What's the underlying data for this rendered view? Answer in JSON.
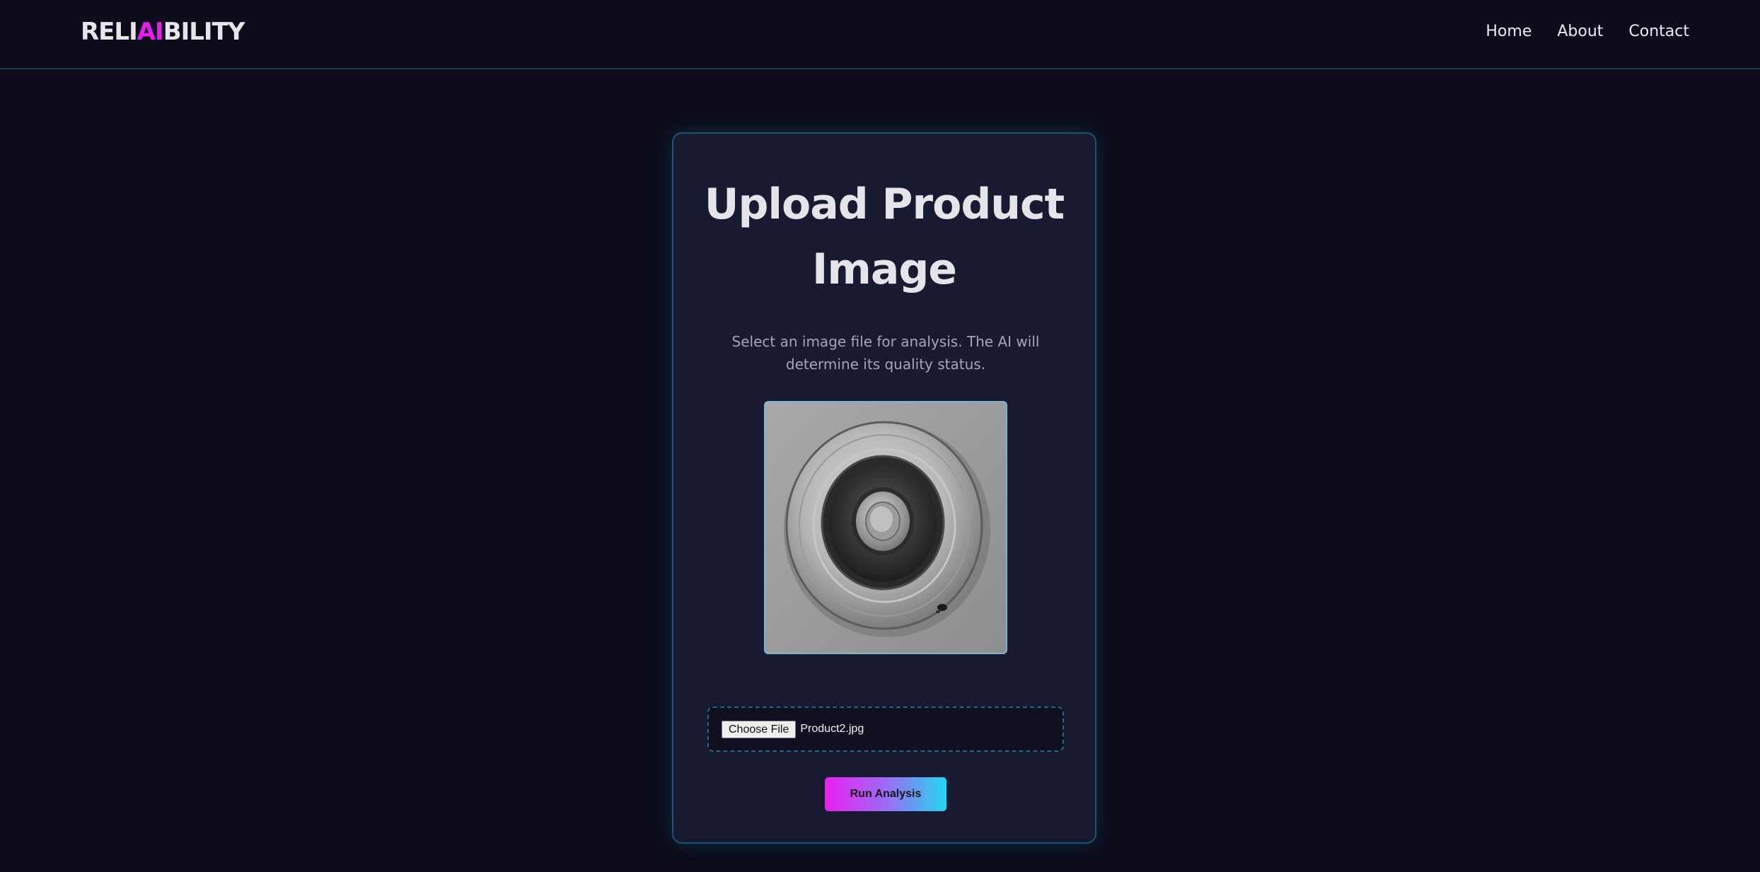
{
  "header": {
    "logo_prefix": "RELI",
    "logo_accent": "AI",
    "logo_suffix": "BILITY",
    "nav": [
      {
        "label": "Home"
      },
      {
        "label": "About"
      },
      {
        "label": "Contact"
      }
    ]
  },
  "main": {
    "title": "Upload Product Image",
    "subtitle": "Select an image file for analysis. The AI will determine its quality status.",
    "file_input": {
      "button_label": "Choose File",
      "selected_file": "Product2.jpg"
    },
    "run_button_label": "Run Analysis"
  },
  "colors": {
    "background": "#0c0c1a",
    "card": "#181a31",
    "accent_magenta": "#e81cf2",
    "accent_cyan": "#22d7f2",
    "border_teal": "#19566e"
  }
}
